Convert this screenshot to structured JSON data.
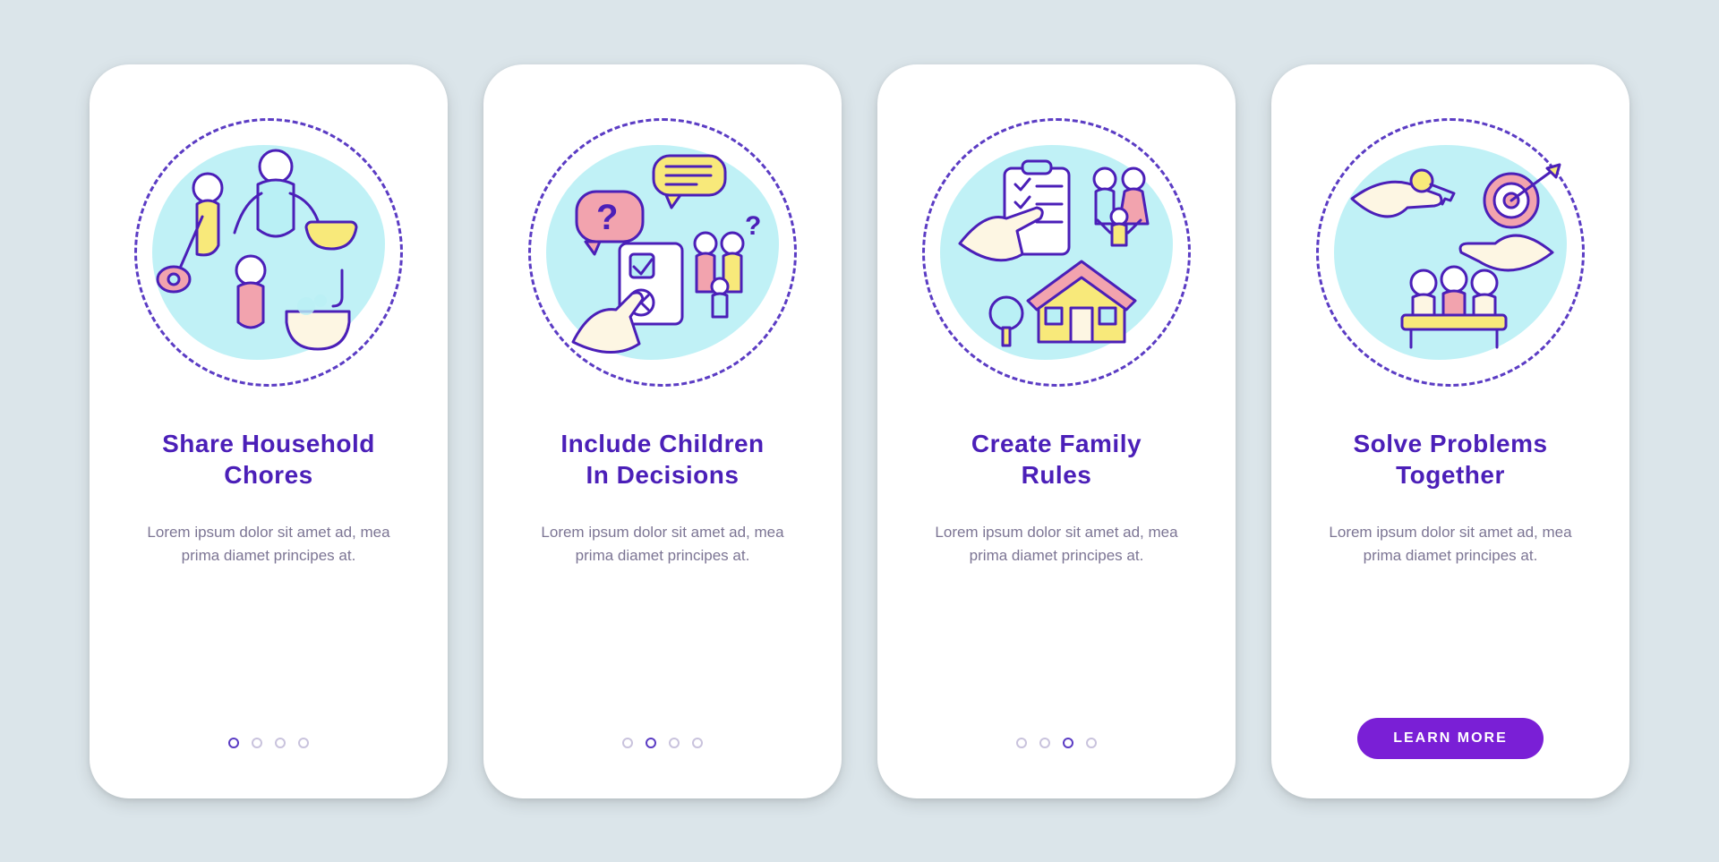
{
  "colors": {
    "background": "#dbe5ea",
    "card_bg": "#ffffff",
    "accent": "#4b1fb8",
    "accent_bright": "#7a1fd6",
    "blob": "#b9f0f5",
    "text_muted": "#7c7594",
    "dot_inactive": "#c9c3dd",
    "fill_yellow": "#f8e97a",
    "fill_pink": "#f2a3ae",
    "fill_cream": "#fdf6e3"
  },
  "screens": [
    {
      "id": "share-chores",
      "icon": "family-chores-illustration",
      "title": "Share Household\nChores",
      "description": "Lorem ipsum dolor sit amet ad, mea prima diamet principes at.",
      "active_dot_index": 0,
      "has_cta": false
    },
    {
      "id": "include-children",
      "icon": "children-decisions-illustration",
      "title": "Include Children\nIn Decisions",
      "description": "Lorem ipsum dolor sit amet ad, mea prima diamet principes at.",
      "active_dot_index": 1,
      "has_cta": false
    },
    {
      "id": "family-rules",
      "icon": "family-rules-illustration",
      "title": "Create Family\nRules",
      "description": "Lorem ipsum dolor sit amet ad, mea prima diamet principes at.",
      "active_dot_index": 2,
      "has_cta": false
    },
    {
      "id": "solve-problems",
      "icon": "solve-problems-illustration",
      "title": "Solve Problems\nTogether",
      "description": "Lorem ipsum dolor sit amet ad, mea prima diamet principes at.",
      "active_dot_index": 3,
      "has_cta": true
    }
  ],
  "dot_count": 4,
  "cta_label": "LEARN MORE"
}
